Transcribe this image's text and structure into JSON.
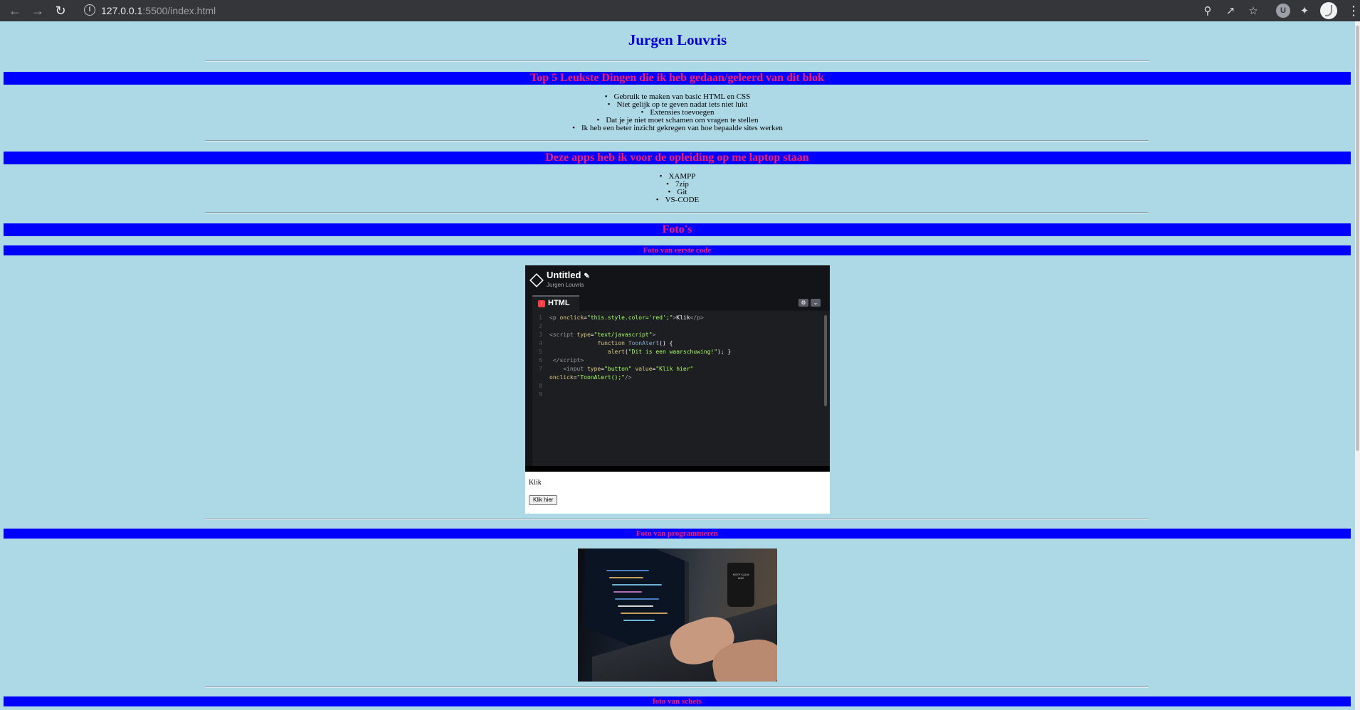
{
  "browser": {
    "url_host": "127.0.0.1",
    "url_path": ":5500/index.html",
    "extension_badge": "U"
  },
  "page": {
    "title": "Jurgen Louvris",
    "sections": {
      "top5": {
        "heading": "Top 5 Leukste Dingen die ik heb gedaan/geleerd van dit blok",
        "items": [
          "Gebruik te maken van basic HTML en CSS",
          "Niet gelijk op te geven nadat iets niet lukt",
          "Extensies toevoegen",
          "Dat je je niet moet schamen om vragen te stellen",
          "Ik heb een beter inzicht gekregen van hoe bepaalde sites werken"
        ]
      },
      "apps": {
        "heading": "Deze apps heb ik voor de opleiding op me laptop staan",
        "items": [
          "XAMPP",
          "7zip",
          "Git",
          "VS-CODE"
        ]
      },
      "photos": {
        "heading": "Foto's",
        "photo1_heading": "Foto van eerste code",
        "photo2_heading": "Foto van programmeren",
        "photo3_heading": "foto van schets"
      }
    }
  },
  "codepen": {
    "title": "Untitled",
    "author": "Jurgen Louvris",
    "tab_label": "HTML",
    "line_numbers": [
      "1",
      "2",
      "3",
      "4",
      "5",
      "6",
      "7",
      "",
      "8",
      "9"
    ],
    "output_text": "Klik",
    "output_button": "Klik hier"
  },
  "mug_text": "KEEP CALM AND"
}
